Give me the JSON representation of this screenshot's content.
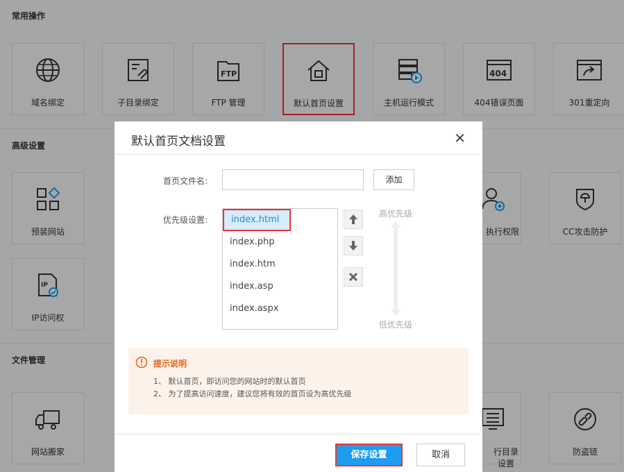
{
  "sections": {
    "common": {
      "title": "常用操作",
      "tiles": [
        {
          "label": "域名绑定",
          "icon": "globe-icon"
        },
        {
          "label": "子目录绑定",
          "icon": "link-doc-icon"
        },
        {
          "label": "FTP 管理",
          "icon": "ftp-folder-icon"
        },
        {
          "label": "默认首页设置",
          "icon": "home-icon"
        },
        {
          "label": "主机运行模式",
          "icon": "server-play-icon"
        },
        {
          "label": "404错误页面",
          "icon": "page-404-icon"
        },
        {
          "label": "301重定向",
          "icon": "redirect-icon"
        }
      ]
    },
    "advanced": {
      "title": "高级设置",
      "tiles": [
        {
          "label": "预装网站",
          "icon": "apps-grid-icon"
        },
        {
          "label": "执行权限",
          "icon": "user-plus-icon"
        },
        {
          "label": "CC攻击防护",
          "icon": "shield-icon"
        },
        {
          "label": "IP访问权",
          "icon": "ip-doc-check-icon"
        }
      ]
    },
    "files": {
      "title": "文件管理",
      "tiles": [
        {
          "label": "网站搬家",
          "icon": "truck-icon"
        },
        {
          "label": "行目录设置",
          "icon": "list-monitor-icon"
        },
        {
          "label": "防盗链",
          "icon": "broken-link-icon"
        }
      ]
    }
  },
  "dialog": {
    "title": "默认首页文档设置",
    "close_glyph": "✕",
    "filename_label": "首页文件名:",
    "filename_value": "",
    "add_label": "添加",
    "priority_label": "优先级设置:",
    "priority_items": [
      "index.html",
      "index.php",
      "index.htm",
      "index.asp",
      "index.aspx"
    ],
    "high_priority": "高优先级",
    "low_priority": "低优先级",
    "tip_title": "提示说明",
    "tip_lines": [
      "1、 默认首页，即访问您的网站时的默认首页",
      "2、 为了提高访问速度，建议您将有效的首页设为高优先级"
    ],
    "save_label": "保存设置",
    "cancel_label": "取消"
  },
  "colors": {
    "accent": "#1d9cf0",
    "highlight": "#e33333",
    "tip": "#e8641b"
  }
}
